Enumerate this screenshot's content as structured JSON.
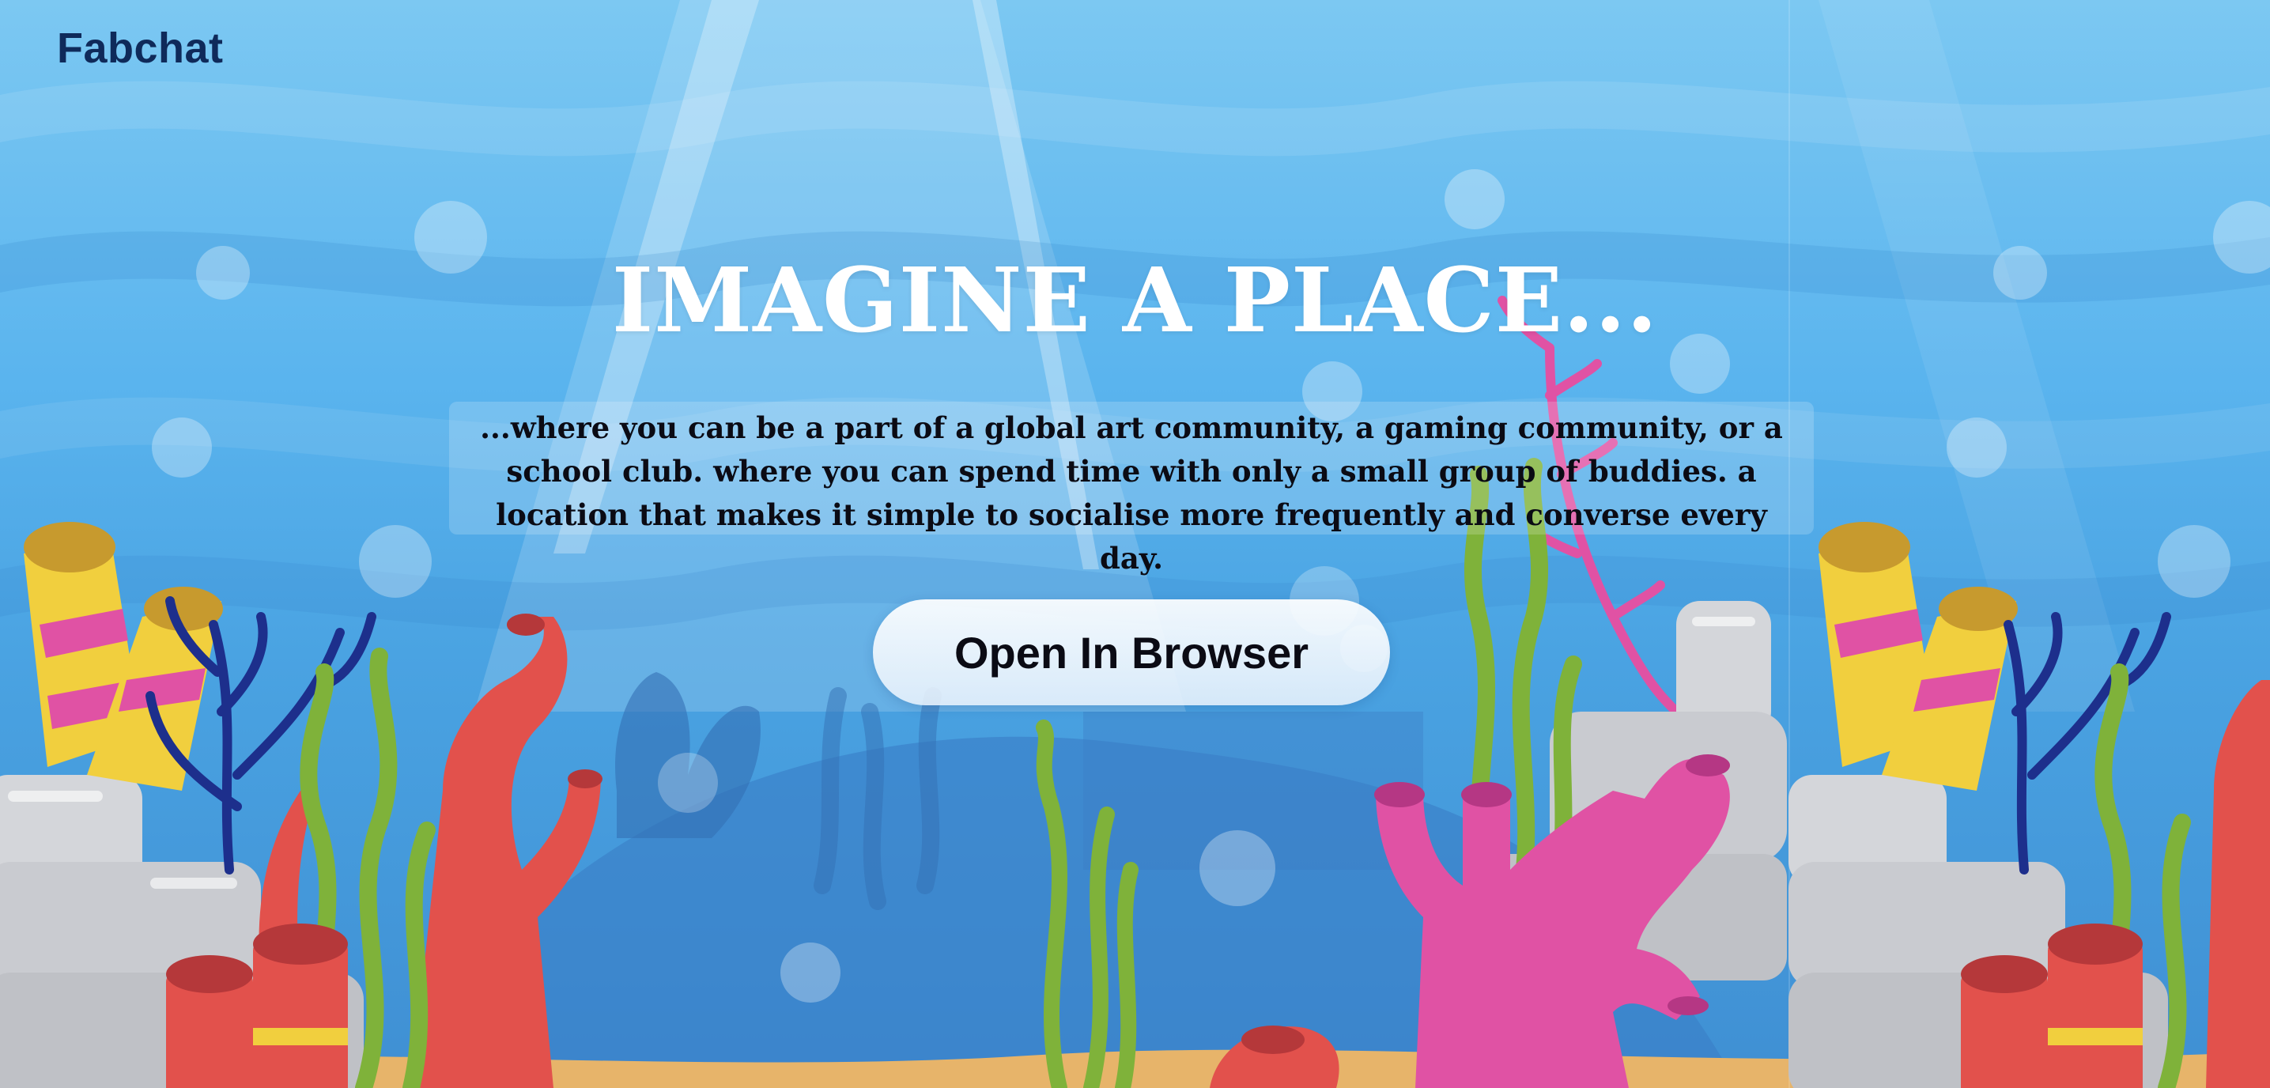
{
  "header": {
    "brand": "Fabchat"
  },
  "hero": {
    "title": "IMAGINE A PLACE...",
    "description": "...where you can be a part of a global art community, a gaming community, or a school club. where you can spend time with only a small group of buddies. a location that makes it simple to socialise more frequently and converse every day.",
    "cta_label": "Open In Browser"
  },
  "colors": {
    "water_top": "#7cc8f2",
    "water_bottom": "#3f8fd3",
    "brand_text": "#0f2a5a",
    "coral_red": "#e2514c",
    "coral_pink": "#e052a4",
    "seaweed_green": "#7fb23a",
    "rock_gray": "#d4d6da",
    "sand": "#e7b46a"
  }
}
